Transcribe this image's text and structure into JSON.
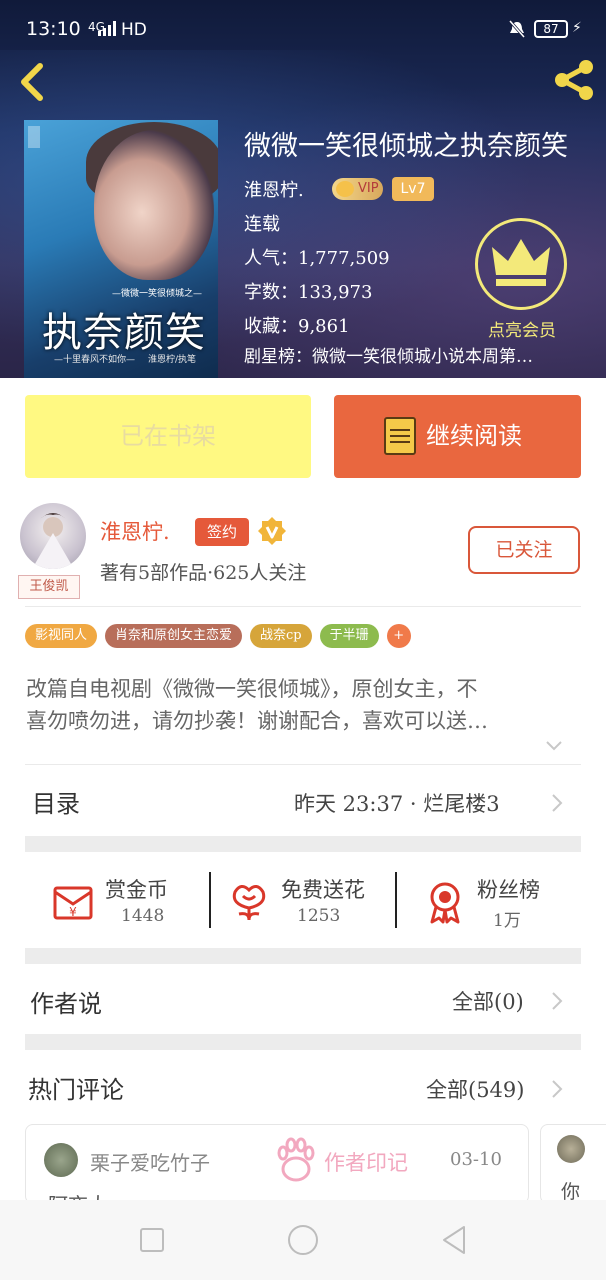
{
  "status_bar": {
    "time": "13:10",
    "network": "4G",
    "hd": "HD",
    "battery": "87"
  },
  "book": {
    "title": "微微一笑很倾城之执奈颜笑",
    "author": "淮恩柠.",
    "vip_label": "VIP",
    "level": "Lv7",
    "status": "连载",
    "popularity_label": "人气：",
    "popularity": "1,777,509",
    "words_label": "字数：",
    "words": "133,973",
    "collections_label": "收藏：",
    "collections": "9,861",
    "ranking": "剧星榜：微微一笑很倾城小说本周第…",
    "member_label": "点亮会员"
  },
  "cover": {
    "subtitle": "—微微一笑很倾城之—",
    "title": "执奈颜笑",
    "tagline": "—十里春风不如你—",
    "author": "淮恩柠/执笔"
  },
  "actions": {
    "shelf_label": "已在书架",
    "read_label": "继续阅读"
  },
  "author_panel": {
    "name": "淮恩柠.",
    "sign_label": "签约",
    "avatar_tag": "王俊凯",
    "meta": "著有5部作品·625人关注",
    "follow_label": "已关注"
  },
  "tags": [
    {
      "label": "影视同人",
      "color": "#f0a842"
    },
    {
      "label": "肖奈和原创女主恋爱",
      "color": "#b86e5a"
    },
    {
      "label": "战奈cp",
      "color": "#d6a53a"
    },
    {
      "label": "于半珊",
      "color": "#8dbb4e"
    },
    {
      "label": "+",
      "color": "#f07a4a"
    }
  ],
  "description": {
    "line1": "改篇自电视剧《微微一笑很倾城》，原创女主，不",
    "line2": "喜勿喷勿进，请勿抄袭！谢谢配合，喜欢可以送…"
  },
  "catalog": {
    "title": "目录",
    "latest": "昨天 23:37 · 烂尾楼3"
  },
  "stats": [
    {
      "label": "赏金币",
      "value": "1448",
      "icon": "red-envelope-icon"
    },
    {
      "label": "免费送花",
      "value": "1253",
      "icon": "flower-icon"
    },
    {
      "label": "粉丝榜",
      "value": "1万",
      "icon": "medal-icon"
    }
  ],
  "author_says": {
    "title": "作者说",
    "link": "全部(0)"
  },
  "hot_comments": {
    "title": "热门评论",
    "link": "全部(549)",
    "first": {
      "user": "栗子爱吃竹子",
      "mark": "作者印记",
      "date": "03-10",
      "text": "阿夜大"
    },
    "second_text": "你"
  },
  "colors": {
    "accent": "#e9673f",
    "shelf": "#fff982",
    "member": "#f3e97a"
  }
}
